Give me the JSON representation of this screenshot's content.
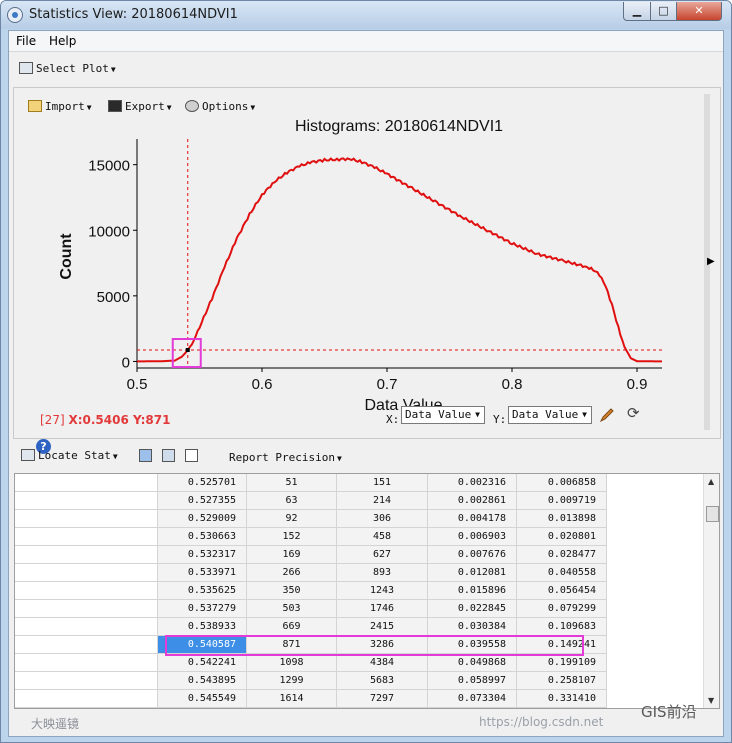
{
  "window": {
    "title": "Statistics View: 20180614NDVI1",
    "min_glyph": "▁",
    "max_glyph": "□",
    "close_glyph": "✕"
  },
  "menu": {
    "file": "File",
    "help": "Help"
  },
  "toolbar": {
    "select_plot": "Select Plot"
  },
  "plot_toolbar": {
    "import": "Import",
    "export": "Export",
    "options": "Options"
  },
  "chart_data": {
    "type": "line",
    "title": "Histograms: 20180614NDVI1",
    "xlabel": "Data Value",
    "ylabel": "Count",
    "xlim": [
      0.5,
      0.92
    ],
    "ylim": [
      -500,
      16500
    ],
    "x_ticks": [
      0.5,
      0.6,
      0.7,
      0.8,
      0.9
    ],
    "x_tick_labels": [
      "0.5",
      "0.6",
      "0.7",
      "0.8",
      "0.9"
    ],
    "y_ticks": [
      0,
      5000,
      10000,
      15000
    ],
    "y_tick_labels": [
      "0",
      "5000",
      "10000",
      "15000"
    ],
    "grid": false,
    "series": [
      {
        "color": "#e01010",
        "x": [
          0.5,
          0.52,
          0.53,
          0.5357,
          0.5373,
          0.5389,
          0.5406,
          0.5422,
          0.5439,
          0.5455,
          0.55,
          0.56,
          0.57,
          0.58,
          0.59,
          0.6,
          0.61,
          0.62,
          0.63,
          0.64,
          0.65,
          0.66,
          0.67,
          0.68,
          0.69,
          0.7,
          0.72,
          0.74,
          0.76,
          0.78,
          0.8,
          0.82,
          0.84,
          0.85,
          0.86,
          0.865,
          0.87,
          0.875,
          0.88,
          0.885,
          0.89,
          0.895,
          0.9,
          0.92
        ],
        "y": [
          0,
          20,
          60,
          350,
          503,
          669,
          871,
          1098,
          1299,
          1614,
          2600,
          4800,
          7200,
          9400,
          11200,
          12700,
          13700,
          14400,
          14900,
          15200,
          15350,
          15400,
          15450,
          15200,
          14800,
          14300,
          13200,
          12100,
          11000,
          10000,
          9000,
          8200,
          7700,
          7450,
          7200,
          7000,
          6600,
          5700,
          4300,
          2600,
          1100,
          250,
          20,
          0
        ]
      }
    ],
    "crosshair": {
      "x": 0.5406,
      "y": 871
    }
  },
  "readout": {
    "index": "[27] ",
    "coord": "X:0.5406 Y:871"
  },
  "axis_controls": {
    "x_label": "X:",
    "x_value": "Data Value",
    "y_label": "Y:",
    "y_value": "Data Value"
  },
  "help": {
    "glyph": "?"
  },
  "icons": {
    "refresh": "⟳"
  },
  "stats_toolbar": {
    "locate_stat": "Locate Stat",
    "report_precision": "Report Precision"
  },
  "table": {
    "rows": [
      [
        "0.525701",
        "51",
        "151",
        "0.002316",
        "0.006858"
      ],
      [
        "0.527355",
        "63",
        "214",
        "0.002861",
        "0.009719"
      ],
      [
        "0.529009",
        "92",
        "306",
        "0.004178",
        "0.013898"
      ],
      [
        "0.530663",
        "152",
        "458",
        "0.006903",
        "0.020801"
      ],
      [
        "0.532317",
        "169",
        "627",
        "0.007676",
        "0.028477"
      ],
      [
        "0.533971",
        "266",
        "893",
        "0.012081",
        "0.040558"
      ],
      [
        "0.535625",
        "350",
        "1243",
        "0.015896",
        "0.056454"
      ],
      [
        "0.537279",
        "503",
        "1746",
        "0.022845",
        "0.079299"
      ],
      [
        "0.538933",
        "669",
        "2415",
        "0.030384",
        "0.109683"
      ],
      [
        "0.540587",
        "871",
        "3286",
        "0.039558",
        "0.149241"
      ],
      [
        "0.542241",
        "1098",
        "4384",
        "0.049868",
        "0.199109"
      ],
      [
        "0.543895",
        "1299",
        "5683",
        "0.058997",
        "0.258107"
      ],
      [
        "0.545549",
        "1614",
        "7297",
        "0.073304",
        "0.331410"
      ]
    ],
    "selected_row": 9
  },
  "footer": {
    "left_text": "大映遥镜",
    "url_text": "https://blog.csdn.net",
    "logo_text": "GIS前沿"
  }
}
